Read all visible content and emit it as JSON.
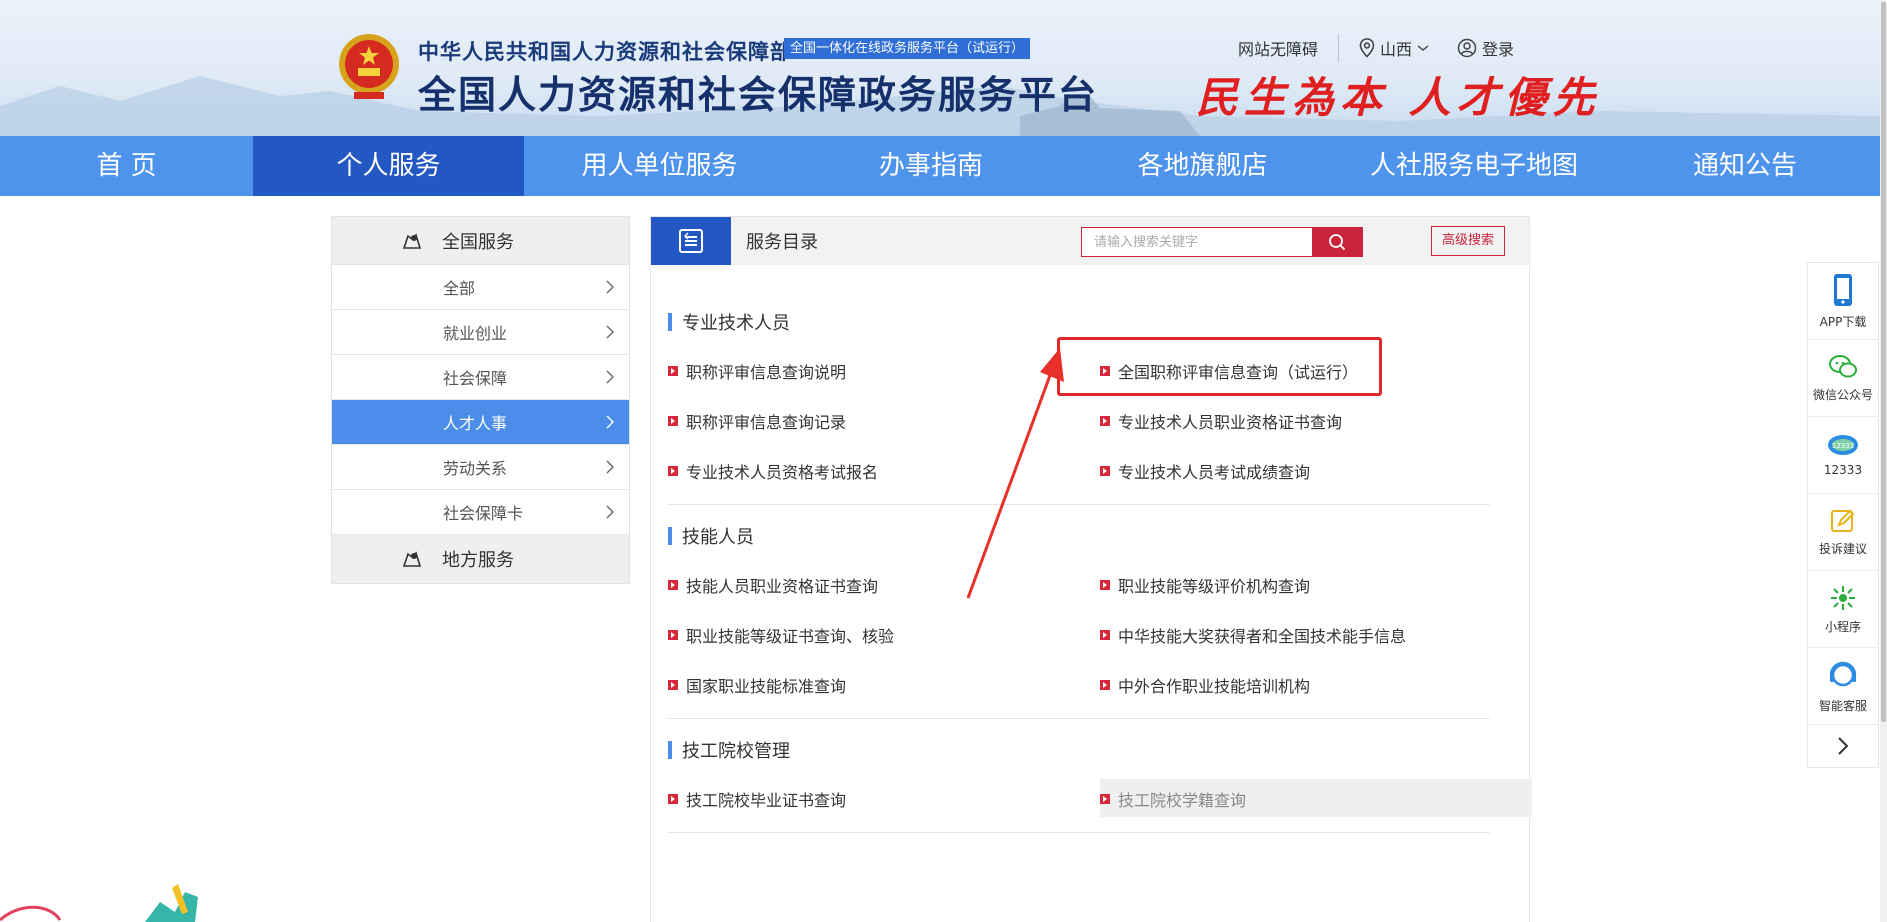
{
  "header": {
    "org_name": "中华人民共和国人力资源和社会保障部",
    "org_tag": "全国一体化在线政务服务平台（试运行）",
    "site_title": "全国人力资源和社会保障政务服务平台",
    "slogan": "民生為本 人才優先",
    "accessibility": "网站无障碍",
    "region": "山西",
    "login": "登录"
  },
  "nav": {
    "items": [
      {
        "label": "首 页"
      },
      {
        "label": "个人服务",
        "active": true
      },
      {
        "label": "用人单位服务"
      },
      {
        "label": "办事指南"
      },
      {
        "label": "各地旗舰店"
      },
      {
        "label": "人社服务电子地图"
      },
      {
        "label": "通知公告"
      }
    ]
  },
  "sidebar": {
    "national": "全国服务",
    "items": [
      {
        "label": "全部"
      },
      {
        "label": "就业创业"
      },
      {
        "label": "社会保障"
      },
      {
        "label": "人才人事",
        "active": true
      },
      {
        "label": "劳动关系"
      },
      {
        "label": "社会保障卡"
      }
    ],
    "local": "地方服务"
  },
  "panel": {
    "title": "服务目录",
    "search_placeholder": "请输入搜索关键字",
    "advanced_search": "高级搜索"
  },
  "sections": [
    {
      "title": "专业技术人员",
      "links": [
        "职称评审信息查询说明",
        "全国职称评审信息查询（试运行）",
        "职称评审信息查询记录",
        "专业技术人员职业资格证书查询",
        "专业技术人员资格考试报名",
        "专业技术人员考试成绩查询"
      ]
    },
    {
      "title": "技能人员",
      "links": [
        "技能人员职业资格证书查询",
        "职业技能等级评价机构查询",
        "职业技能等级证书查询、核验",
        "中华技能大奖获得者和全国技术能手信息",
        "国家职业技能标准查询",
        "中外合作职业技能培训机构"
      ]
    },
    {
      "title": "技工院校管理",
      "links": [
        "技工院校毕业证书查询",
        "技工院校学籍查询"
      ]
    }
  ],
  "float_bar": {
    "items": [
      {
        "label": "APP下载",
        "icon": "phone-icon"
      },
      {
        "label": "微信公众号",
        "icon": "wechat-icon"
      },
      {
        "label": "12333",
        "icon": "hotline-icon"
      },
      {
        "label": "投诉建议",
        "icon": "feedback-icon"
      },
      {
        "label": "小程序",
        "icon": "miniprogram-icon"
      },
      {
        "label": "智能客服",
        "icon": "service-icon"
      }
    ]
  },
  "colors": {
    "nav_bg": "#4f94ec",
    "nav_active": "#2357c4",
    "accent_red": "#c9243b",
    "sidebar_active": "#4b8de8"
  }
}
